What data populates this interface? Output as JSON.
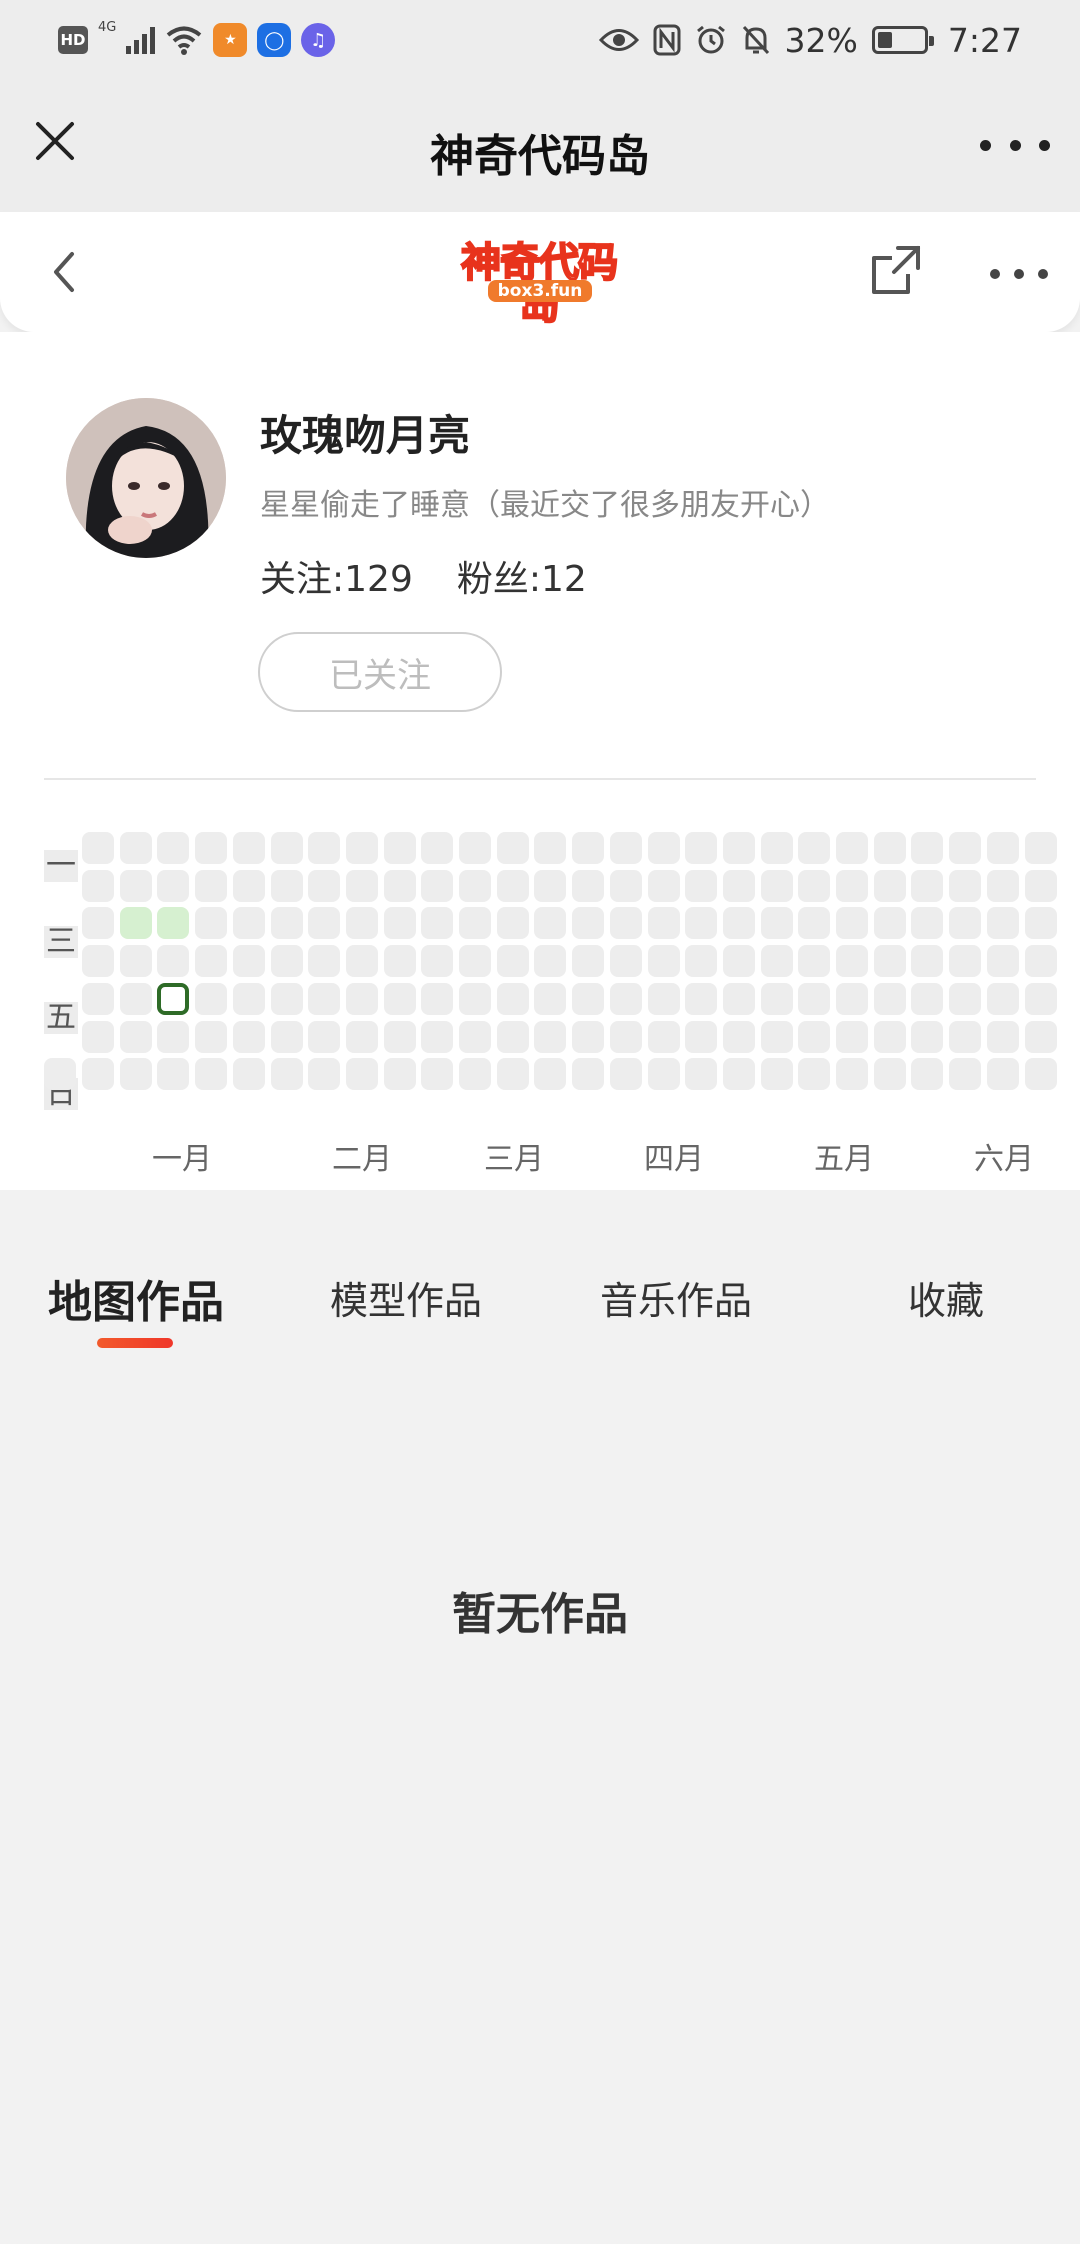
{
  "status_bar": {
    "hd": "HD",
    "network": "4G",
    "battery_text": "32%",
    "battery_level": 0.32,
    "time": "7:27",
    "icons": [
      "signal-icon",
      "wifi-icon",
      "app-notification-icon",
      "bulb-app-icon",
      "music-app-icon",
      "eye-icon",
      "nfc-icon",
      "alarm-icon",
      "mute-icon",
      "battery-icon"
    ]
  },
  "title_bar": {
    "title": "神奇代码岛",
    "close_icon": "close-icon",
    "more_icon": "more-icon"
  },
  "page_header": {
    "logo_text": "神奇代码岛",
    "logo_domain": "box3.fun",
    "back_icon": "chevron-left-icon",
    "share_icon": "share-icon",
    "more_icon": "more-icon"
  },
  "profile": {
    "name": "玫瑰吻月亮",
    "bio": "星星偷走了睡意（最近交了很多朋友开心）",
    "following": "关注:129",
    "followers": "粉丝:12",
    "follow_button": "已关注"
  },
  "activity": {
    "day_labels": [
      "一",
      "三",
      "五",
      "日"
    ],
    "months": [
      "一月",
      "二月",
      "三月",
      "四月",
      "五月",
      "六月"
    ],
    "active_days": [
      "week2-wed",
      "week3-wed"
    ],
    "selected_day": "week3-fri",
    "colors": {
      "empty": "#ededed",
      "level1": "#d6f0d0",
      "selected_border": "#2e6b27"
    }
  },
  "tabs": [
    {
      "label": "地图作品",
      "active": true
    },
    {
      "label": "模型作品",
      "active": false
    },
    {
      "label": "音乐作品",
      "active": false
    },
    {
      "label": "收藏",
      "active": false
    }
  ],
  "empty_state": "暂无作品",
  "colors": {
    "accent": "#f0372a",
    "logo_red": "#e8331c",
    "logo_orange": "#f07a2c"
  }
}
